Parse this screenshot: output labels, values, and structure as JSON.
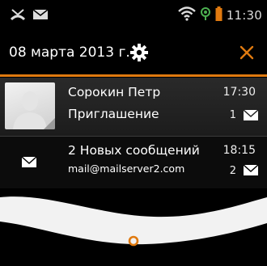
{
  "status_bar": {
    "time": "11:30",
    "icons": [
      "missed-call-icon",
      "envelope-icon",
      "wifi-icon",
      "signal-icon",
      "battery-low-icon"
    ]
  },
  "header": {
    "date": "08 марта 2013 г.",
    "settings_icon": "gear-icon",
    "close_icon": "close-icon"
  },
  "notifications": [
    {
      "title": "Сорокин Петр",
      "subtitle": "Приглашение",
      "time": "17:30",
      "count": "1",
      "icon": "envelope-icon"
    },
    {
      "title": "2 Новых сообщений",
      "subtitle": "mail@mailserver2.com",
      "time": "18:15",
      "count": "2",
      "icon": "envelope-icon"
    }
  ],
  "colors": {
    "accent": "#e07a10",
    "background": "#000000",
    "text": "#ffffff"
  }
}
